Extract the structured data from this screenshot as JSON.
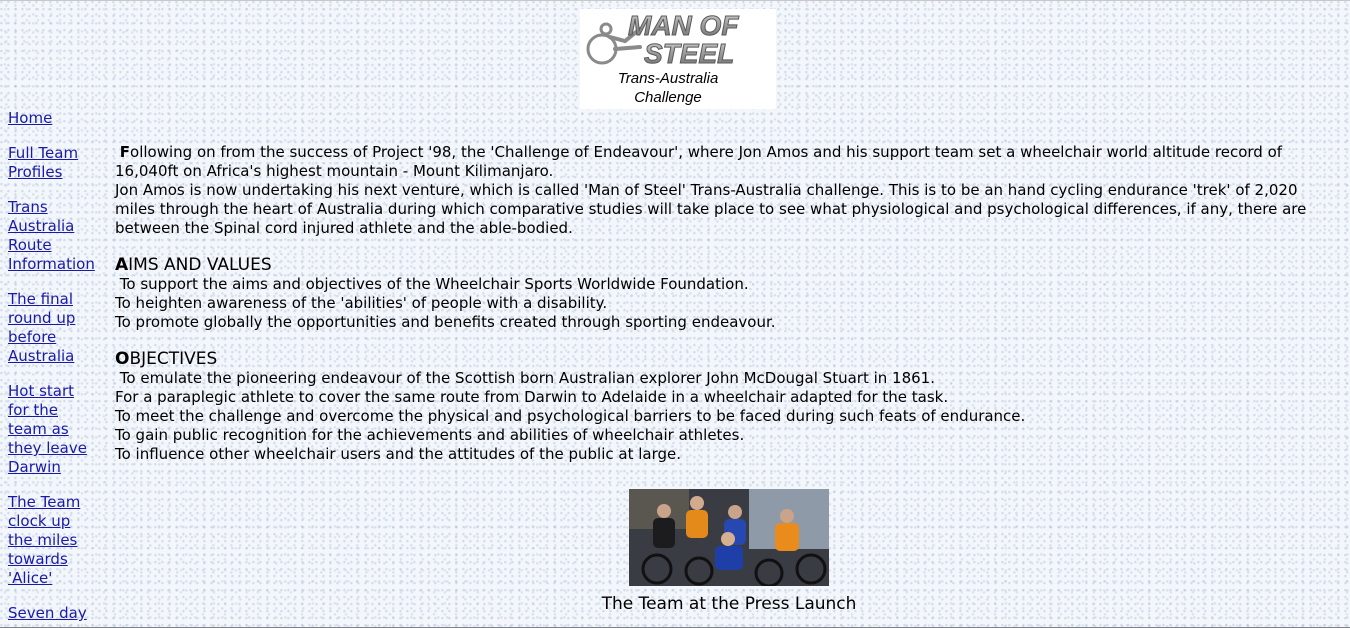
{
  "logo": {
    "line1": "MAN OF",
    "line2": "STEEL",
    "subtitle_line1": "Trans-Australia",
    "subtitle_line2": "Challenge"
  },
  "sidebar": {
    "links": [
      {
        "label": "Home"
      },
      {
        "label": "Full Team Profiles"
      },
      {
        "label": "Trans Australia Route Information"
      },
      {
        "label": "The final round up before Australia"
      },
      {
        "label": "Hot start for the team as they leave Darwin"
      },
      {
        "label": "The Team clock up the miles towards 'Alice'"
      },
      {
        "label": "Seven day"
      }
    ]
  },
  "intro": {
    "dropcap": "F",
    "line1": "ollowing on from the success of Project '98, the 'Challenge of Endeavour', where Jon Amos and his support team set a wheelchair world altitude record of 16,040ft on Africa's highest mountain - Mount Kilimanjaro.",
    "line2": "Jon Amos is now undertaking his next venture, which is called 'Man of Steel' Trans-Australia challenge. This is to be an hand cycling endurance 'trek' of 2,020 miles through the heart of Australia during which comparative studies will take place to see what physiological and psychological differences, if any, there are between the Spinal cord injured athlete and the able-bodied."
  },
  "aims": {
    "heading_drop": "A",
    "heading_rest": "IMS AND VALUES",
    "items": [
      "To support the aims and objectives of the Wheelchair Sports Worldwide Foundation.",
      "To heighten awareness of the 'abilities' of people with a disability.",
      "To promote globally the opportunities and benefits created through sporting endeavour."
    ]
  },
  "objectives": {
    "heading_drop": "O",
    "heading_rest": "BJECTIVES",
    "items": [
      "To emulate the pioneering endeavour of the Scottish born Australian explorer John McDougal Stuart in 1861.",
      "For a paraplegic athlete to cover the same route from Darwin to Adelaide in a wheelchair adapted for the task.",
      "To meet the challenge and overcome the physical and psychological barriers to be faced during such feats of endurance.",
      "To gain public recognition for the achievements and abilities of wheelchair athletes.",
      "To influence other wheelchair users and the attitudes of the public at large."
    ]
  },
  "photo": {
    "caption": "The Team at the Press Launch"
  },
  "colors": {
    "link": "#1a1aa8",
    "background": "#f3f6fa",
    "logo_metal": "#8a8a8a"
  }
}
